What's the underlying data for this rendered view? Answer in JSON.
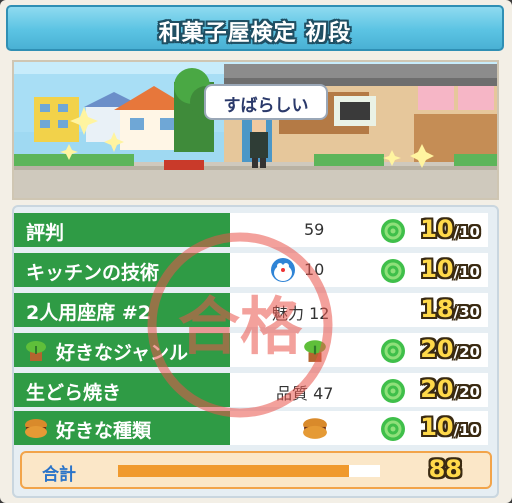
{
  "header": {
    "title": "和菓子屋検定 初段"
  },
  "scene": {
    "speech_text": "すばらしい"
  },
  "rows": [
    {
      "label": "評判",
      "value": "59",
      "score": "10",
      "max": "/10",
      "icon": "target-icon"
    },
    {
      "label": "キッチンの技術",
      "value": "10",
      "score": "10",
      "max": "/10",
      "icon": "target-icon",
      "value_icon": "robot-cat-face-icon"
    },
    {
      "label": "2人用座席 #2",
      "value": "魅力 12",
      "score": "18",
      "max": "/30"
    },
    {
      "label": "好きなジャンル",
      "value": "",
      "score": "20",
      "max": "/20",
      "icon": "target-icon",
      "label_icon": "plant-icon",
      "value_icon": "plant-icon"
    },
    {
      "label": "生どら焼き",
      "value": "品質 47",
      "score": "20",
      "max": "/20",
      "icon": "target-icon"
    },
    {
      "label": "好きな種類",
      "value": "",
      "score": "10",
      "max": "/10",
      "icon": "target-icon",
      "label_icon": "dorayaki-icon",
      "value_icon": "dorayaki-icon"
    }
  ],
  "total": {
    "label": "合計",
    "value": "88",
    "progress_percent": 88
  },
  "stamp": {
    "text": "合格"
  },
  "colors": {
    "label_bg": "#2f9b45",
    "header_bg": "#5bc3e3",
    "score_yellow": "#ffd94a",
    "stamp_red": "#e9534a",
    "bar_fill": "#f09a2e"
  }
}
